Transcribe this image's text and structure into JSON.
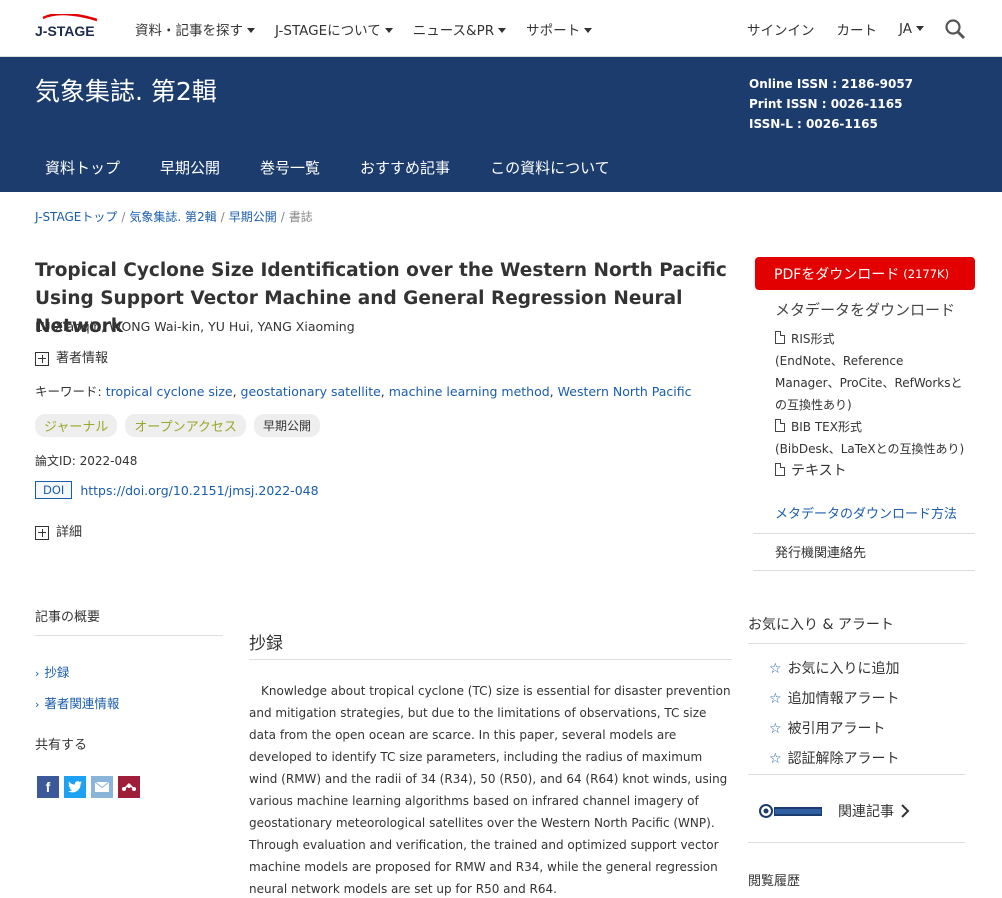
{
  "topbar": {
    "logo": "J-STAGE",
    "nav": [
      "資料・記事を探す",
      "J-STAGEについて",
      "ニュース&PR",
      "サポート"
    ],
    "signin": "サインイン",
    "cart": "カート",
    "lang": "JA"
  },
  "banner": {
    "journal_title": "気象集誌. 第2輯",
    "issn_online": "Online ISSN : 2186-9057",
    "issn_print": "Print ISSN : 0026-1165",
    "issn_l": "ISSN-L : 0026-1165",
    "nav": [
      "資料トップ",
      "早期公開",
      "巻号一覧",
      "おすすめ記事",
      "この資料について"
    ]
  },
  "breadcrumb": [
    "J-STAGEトップ",
    "気象集誌. 第2輯",
    "早期公開",
    "書誌"
  ],
  "article": {
    "title": "Tropical Cyclone Size Identification over the Western North Pacific Using Support Vector Machine and General Regression Neural Network",
    "authors": "LU Xiaoqin, WONG Wai-kin, YU Hui, YANG Xiaoming",
    "author_info": "著者情報",
    "keywords_label": "キーワード:",
    "keywords": [
      "tropical cyclone size",
      "geostationary satellite",
      "machine learning method",
      "Western North Pacific"
    ],
    "tags": [
      "ジャーナル",
      "オープンアクセス",
      "早期公開"
    ],
    "article_id": "論文ID: 2022-048",
    "doi_badge": "DOI",
    "doi_link": "https://doi.org/10.2151/jmsj.2022-048",
    "details": "詳細"
  },
  "sidebar": {
    "pdf_label": "PDFをダウンロード",
    "pdf_size": "(2177K)",
    "meta_head": "メタデータをダウンロード",
    "ris": "RIS形式",
    "ris_sub": "(EndNote、Reference Manager、ProCite、RefWorksとの互換性あり)",
    "bib": "BIB TEX形式",
    "bib_sub": "(BibDesk、LaTeXとの互換性あり)",
    "text": "テキスト",
    "meta_method": "メタデータのダウンロード方法",
    "publisher": "発行機関連絡先"
  },
  "lower_left": {
    "overview": "記事の概要",
    "toc": [
      "抄録",
      "著者関連情報"
    ],
    "share": "共有する"
  },
  "abstract": {
    "heading": "抄録",
    "body": "Knowledge about tropical cyclone (TC) size is essential for disaster prevention and mitigation strategies, but due to the limitations of observations, TC size data from the open ocean are scarce. In this paper, several models are developed to identify TC size parameters, including the radius of maximum wind (RMW) and the radii of 34 (R34), 50 (R50), and 64 (R64) knot winds, using various machine learning algorithms based on infrared channel imagery of geostationary meteorological satellites over the Western North Pacific (WNP). Through evaluation and verification, the trained and optimized support vector machine models are proposed for RMW and R34, while the general regression neural network models are set up for R50 and R64."
  },
  "favorites": {
    "heading": "お気に入り & アラート",
    "items": [
      "お気に入りに追加",
      "追加情報アラート",
      "被引用アラート",
      "認証解除アラート"
    ],
    "related": "関連記事",
    "history": "閲覧履歴"
  },
  "colors": {
    "banner": "#1d3c6e",
    "pdf": "#e30000",
    "link": "#1a5dab"
  }
}
